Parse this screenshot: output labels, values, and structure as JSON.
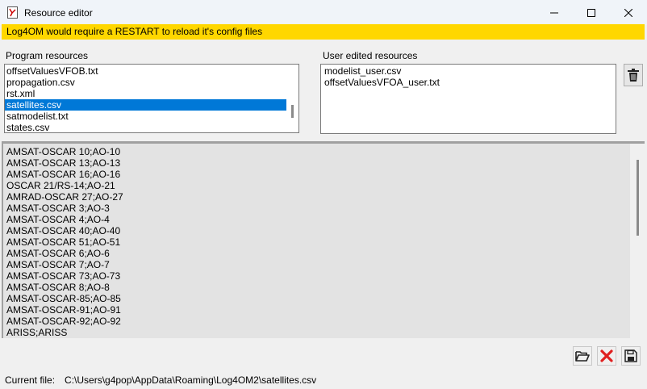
{
  "window": {
    "title": "Resource editor"
  },
  "banner": {
    "text": "Log4OM would require a RESTART to reload it's config files"
  },
  "program_resources": {
    "label": "Program resources",
    "items": [
      "offsetValuesVFOB.txt",
      "propagation.csv",
      "rst.xml",
      "satellites.csv",
      "satmodelist.txt",
      "states.csv"
    ],
    "selected": "satellites.csv"
  },
  "user_resources": {
    "label": "User edited resources",
    "items": [
      "modelist_user.csv",
      "offsetValuesVFOA_user.txt"
    ]
  },
  "editor": {
    "lines": [
      "AMSAT-OSCAR 10;AO-10",
      "AMSAT-OSCAR 13;AO-13",
      "AMSAT-OSCAR 16;AO-16",
      "OSCAR 21/RS-14;AO-21",
      "AMRAD-OSCAR 27;AO-27",
      "AMSAT-OSCAR 3;AO-3",
      "AMSAT-OSCAR 4;AO-4",
      "AMSAT-OSCAR 40;AO-40",
      "AMSAT-OSCAR 51;AO-51",
      "AMSAT-OSCAR 6;AO-6",
      "AMSAT-OSCAR 7;AO-7",
      "AMSAT-OSCAR 73;AO-73",
      "AMSAT-OSCAR 8;AO-8",
      "AMSAT-OSCAR-85;AO-85",
      "AMSAT-OSCAR-91;AO-91",
      "AMSAT-OSCAR-92;AO-92",
      "ARISS;ARISS"
    ]
  },
  "status": {
    "label": "Current file:",
    "path": "C:\\Users\\g4pop\\AppData\\Roaming\\Log4OM2\\satellites.csv"
  },
  "icons": {
    "delete": "trash-icon",
    "open": "folder-open-icon",
    "cancel": "red-x-icon",
    "save": "save-icon"
  },
  "colors": {
    "banner": "#ffd700",
    "selection": "#0078d7",
    "cancel": "#e02020"
  }
}
